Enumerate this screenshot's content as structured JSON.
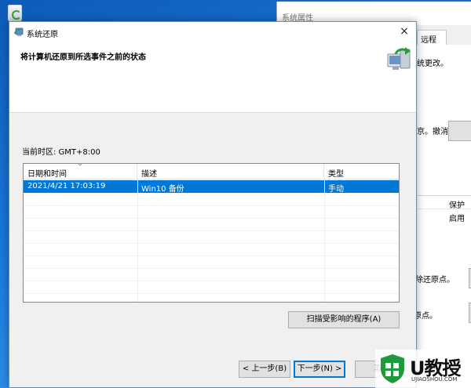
{
  "background_window": {
    "title": "系统属性",
    "tab_remote": "远程",
    "text_changes": "统更改。",
    "text_undo": "京。撤消",
    "col_protect": "保护",
    "val_enabled": "启用",
    "text_delete_points": "删除还原点。",
    "text_restore_points": "原点。"
  },
  "dialog": {
    "title": "系统还原",
    "close_label": "×",
    "header_title": "将计算机还原到所选事件之前的状态",
    "timezone": "当前时区: GMT+8:00",
    "table": {
      "columns": [
        "日期和时间",
        "描述",
        "类型"
      ],
      "rows": [
        {
          "datetime": "2021/4/21 17:03:19",
          "description": "Win10 备份",
          "type": "手动",
          "selected": true
        }
      ]
    },
    "scan_button": "扫描受影响的程序(A)",
    "back_button": "< 上一步(B)",
    "next_button": "下一步(N) >",
    "cancel_button": "取"
  },
  "watermark": {
    "brand": "U教授",
    "url": "UJIAOSHOU.COM"
  },
  "colors": {
    "selection": "#0078d7",
    "desktop": "#1a78d8"
  }
}
